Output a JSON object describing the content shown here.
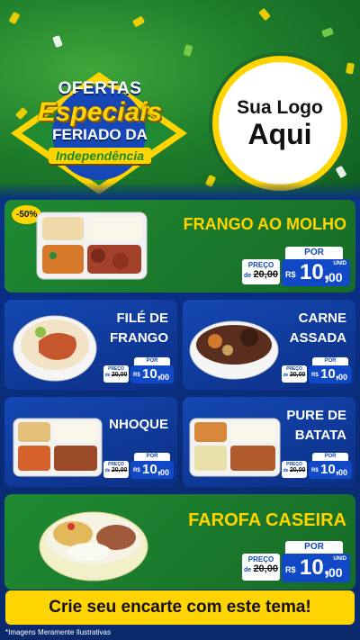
{
  "header": {
    "title_line1": "OFERTAS",
    "title_line2": "Especiais",
    "title_line3": "FERIADO DA",
    "title_line4": "Independência",
    "logo_line1": "Sua Logo",
    "logo_line2": "Aqui"
  },
  "products": [
    {
      "name_line1": "FRANGO AO MOLHO",
      "name_line2": "",
      "badge": "-50%",
      "por": "POR",
      "preco_label": "PREÇO",
      "old_prefix": "de",
      "old_price": "20,00",
      "currency": "R$",
      "price_int": "10,",
      "price_dec": "00",
      "unit": "UNID"
    },
    {
      "name_line1": "FILÉ DE",
      "name_line2": "FRANGO",
      "por": "POR",
      "preco_label": "PREÇO",
      "old_prefix": "de",
      "old_price": "20,00",
      "currency": "R$",
      "price_int": "10,",
      "price_dec": "00",
      "unit": "UNID"
    },
    {
      "name_line1": "CARNE",
      "name_line2": "ASSADA",
      "por": "POR",
      "preco_label": "PREÇO",
      "old_prefix": "de",
      "old_price": "20,00",
      "currency": "R$",
      "price_int": "10,",
      "price_dec": "00",
      "unit": "UNID"
    },
    {
      "name_line1": "NHOQUE",
      "name_line2": "",
      "por": "POR",
      "preco_label": "PREÇO",
      "old_prefix": "de",
      "old_price": "20,00",
      "currency": "R$",
      "price_int": "10,",
      "price_dec": "00",
      "unit": "UNID"
    },
    {
      "name_line1": "PURE DE",
      "name_line2": "BATATA",
      "por": "POR",
      "preco_label": "PREÇO",
      "old_prefix": "de",
      "old_price": "20,00",
      "currency": "R$",
      "price_int": "10,",
      "price_dec": "00",
      "unit": "UNID"
    },
    {
      "name_line1": "FAROFA CASEIRA",
      "name_line2": "",
      "por": "POR",
      "preco_label": "PREÇO",
      "old_prefix": "de",
      "old_price": "20,00",
      "currency": "R$",
      "price_int": "10,",
      "price_dec": "00",
      "unit": "UNID"
    }
  ],
  "footer": {
    "banner": "Crie seu encarte com este tema!",
    "disclaimer": "*Imagens Meramente Ilustrativas"
  },
  "colors": {
    "yellow": "#ffd400",
    "green": "#1f8a32",
    "blue": "#1148c6",
    "navy": "#0a2f86"
  }
}
